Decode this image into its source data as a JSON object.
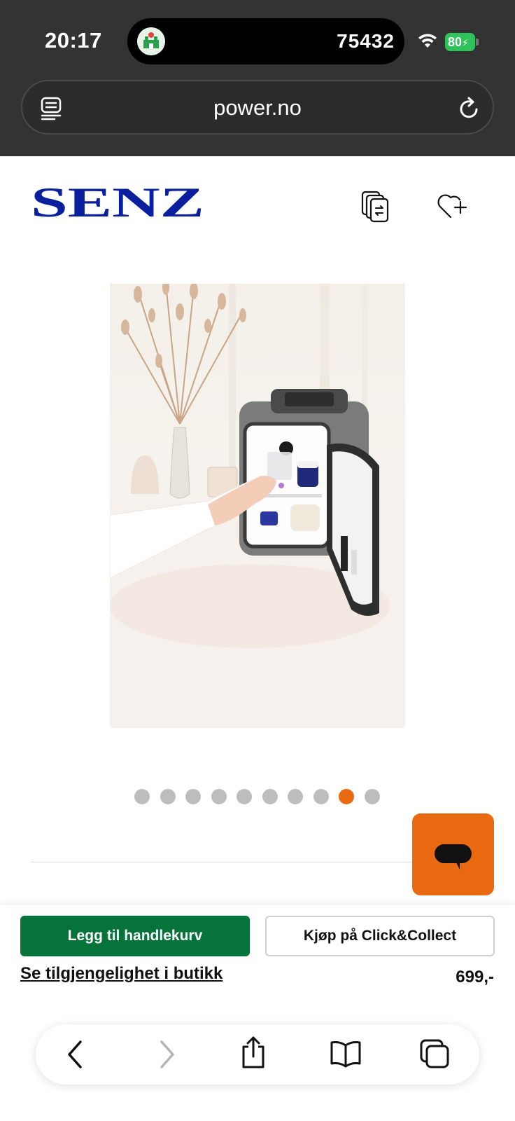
{
  "status_bar": {
    "time": "20:17",
    "live_activity_number": "75432",
    "battery": "80"
  },
  "browser": {
    "url": "power.no"
  },
  "header": {
    "brand_logo_text": "SENZ"
  },
  "carousel": {
    "total": 10,
    "active_index": 8
  },
  "actions": {
    "add_to_cart": "Legg til handlekurv",
    "click_collect": "Kjøp på Click&Collect",
    "store_availability": "Se tilgjengelighet i butikk",
    "price": "699,-"
  },
  "colors": {
    "accent_orange": "#ea6a11",
    "cart_green": "#06733b",
    "logo_blue": "#0a1f9e",
    "battery_green": "#2fc15a"
  },
  "icons": {
    "reader": "reader-icon",
    "reload": "reload-icon",
    "compare": "compare-icon",
    "wishlist": "heart-plus-icon",
    "chat": "chat-icon",
    "back": "chevron-left-icon",
    "forward": "chevron-right-icon",
    "share": "share-icon",
    "bookmarks": "book-icon",
    "tabs": "tabs-icon"
  }
}
